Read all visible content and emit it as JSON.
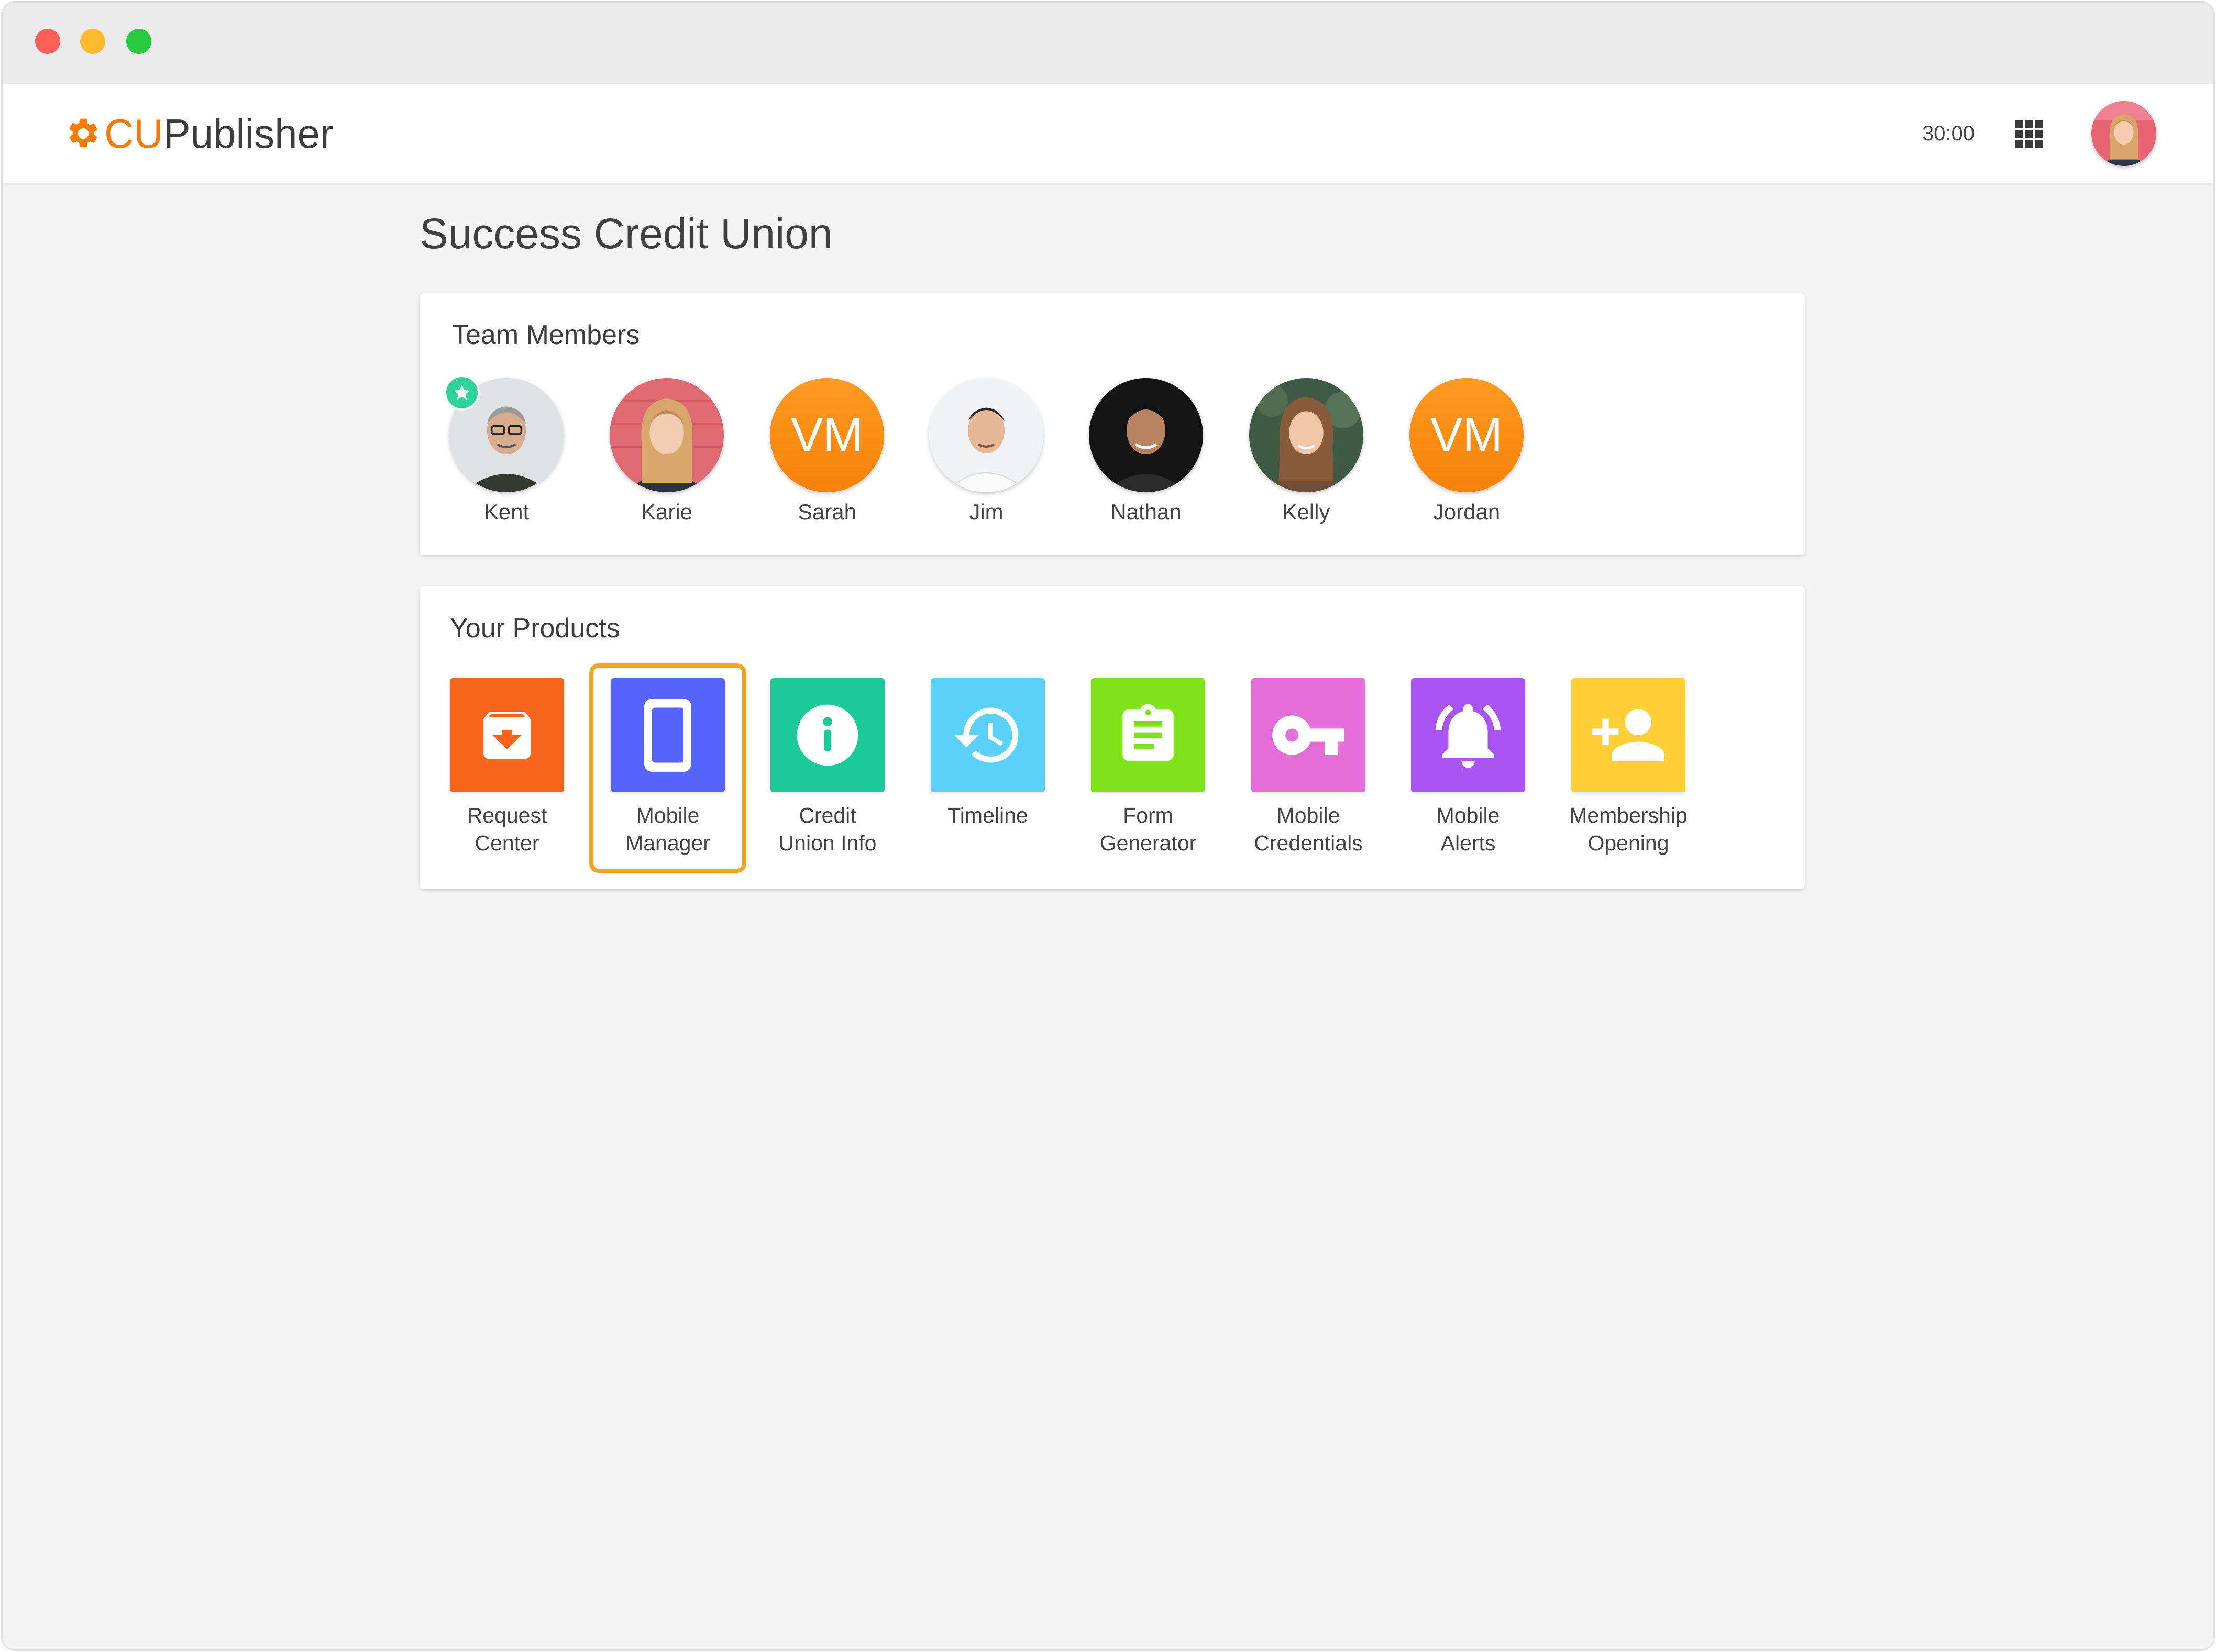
{
  "window": {
    "controls": [
      "close",
      "minimize",
      "zoom"
    ]
  },
  "appbar": {
    "brand_cu": "CU",
    "brand_publisher": "Publisher",
    "timer": "30:00",
    "apps_icon": "apps-grid-icon",
    "brand_color": "#f57c00"
  },
  "page": {
    "title": "Success Credit Union"
  },
  "team": {
    "title": "Team Members",
    "members": [
      {
        "name": "Kent",
        "type": "photo",
        "starred": true
      },
      {
        "name": "Karie",
        "type": "photo"
      },
      {
        "name": "Sarah",
        "type": "initials",
        "initials": "VM"
      },
      {
        "name": "Jim",
        "type": "photo"
      },
      {
        "name": "Nathan",
        "type": "photo"
      },
      {
        "name": "Kelly",
        "type": "photo"
      },
      {
        "name": "Jordan",
        "type": "initials",
        "initials": "VM"
      }
    ]
  },
  "products": {
    "title": "Your Products",
    "selected": "Mobile Manager",
    "items": [
      {
        "label": "Request\nCenter",
        "icon": "archive-download-icon",
        "color": "#f7651d"
      },
      {
        "label": "Mobile\nManager",
        "icon": "smartphone-icon",
        "color": "#5564fb"
      },
      {
        "label": "Credit\nUnion Info",
        "icon": "info-icon",
        "color": "#1bc99b"
      },
      {
        "label": "Timeline",
        "icon": "history-clock-icon",
        "color": "#5bd1fa"
      },
      {
        "label": "Form\nGenerator",
        "icon": "clipboard-form-icon",
        "color": "#7ee11a"
      },
      {
        "label": "Mobile\nCredentials",
        "icon": "key-icon",
        "color": "#e46ed9"
      },
      {
        "label": "Mobile\nAlerts",
        "icon": "bell-ringing-icon",
        "color": "#a955f4"
      },
      {
        "label": "Membership\nOpening",
        "icon": "add-person-icon",
        "color": "#ffd038"
      }
    ]
  }
}
